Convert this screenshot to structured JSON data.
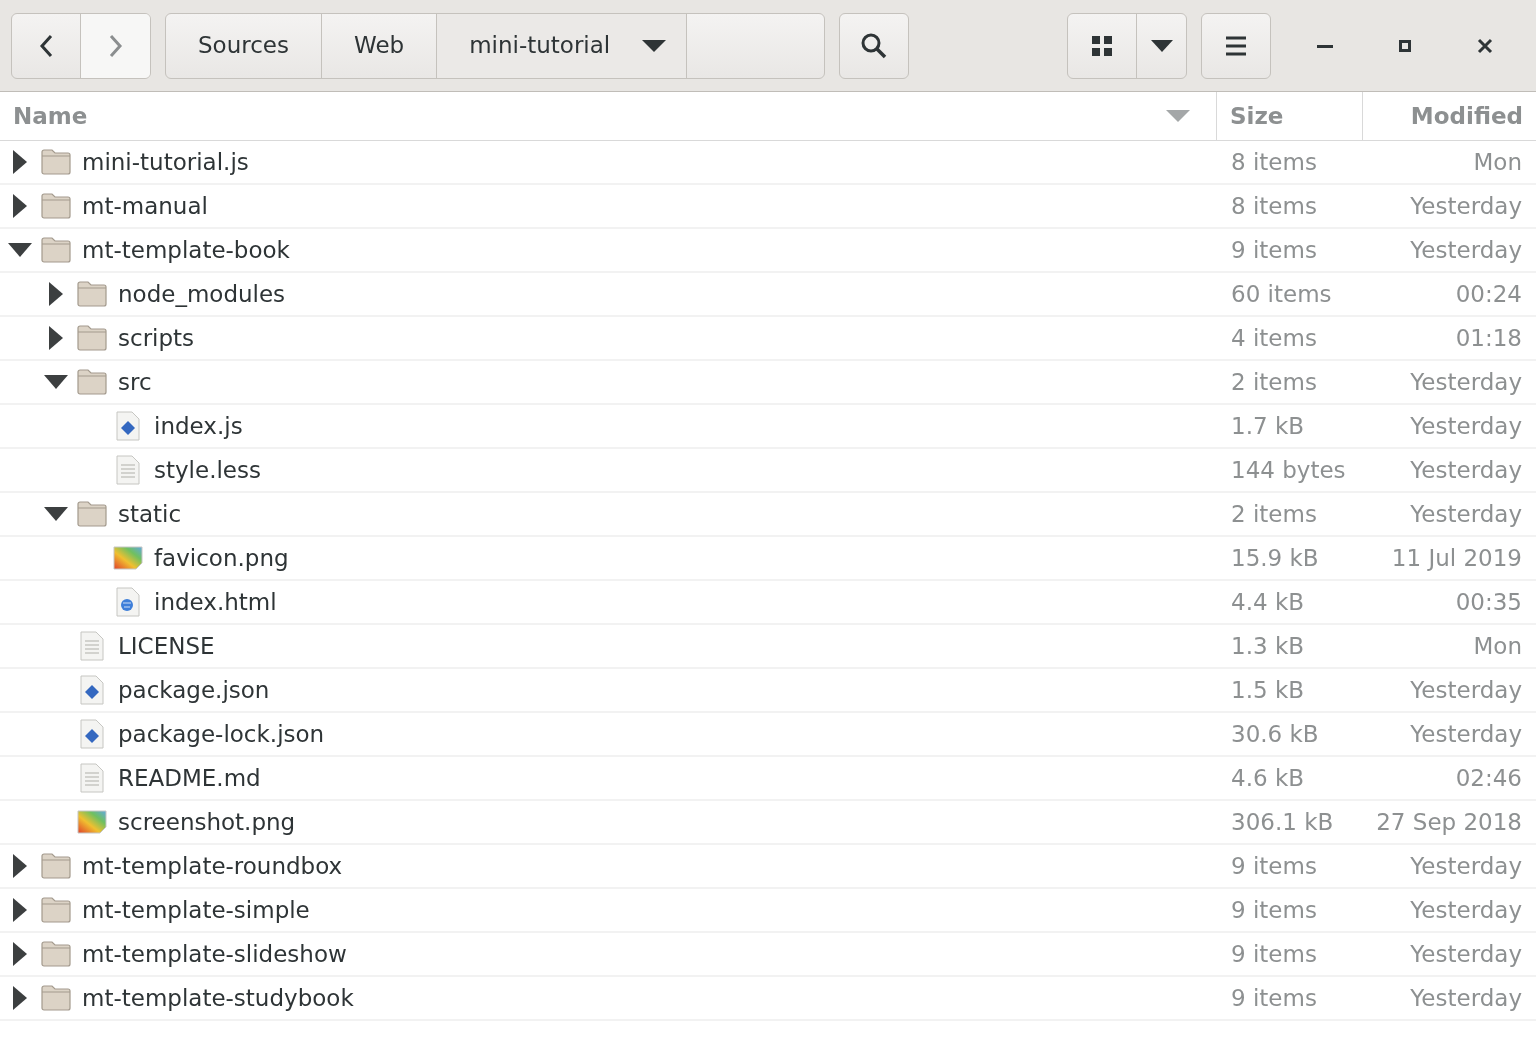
{
  "toolbar": {
    "path": [
      {
        "label": "Sources",
        "selected": false
      },
      {
        "label": "Web",
        "selected": false
      },
      {
        "label": "mini-tutorial",
        "selected": true
      }
    ]
  },
  "columns": [
    {
      "label": "Name",
      "sorted": true
    },
    {
      "label": "Size",
      "sorted": false
    },
    {
      "label": "Modified",
      "sorted": false
    }
  ],
  "files": [
    {
      "name": "mini-tutorial.js",
      "kind": "folder",
      "expanded": false,
      "size": "8 items",
      "modified": "Mon"
    },
    {
      "name": "mt-manual",
      "kind": "folder",
      "expanded": false,
      "size": "8 items",
      "modified": "Yesterday"
    },
    {
      "name": "mt-template-book",
      "kind": "folder",
      "expanded": true,
      "size": "9 items",
      "modified": "Yesterday",
      "children": [
        {
          "name": "node_modules",
          "kind": "folder",
          "expanded": false,
          "size": "60 items",
          "modified": "00:24"
        },
        {
          "name": "scripts",
          "kind": "folder",
          "expanded": false,
          "size": "4 items",
          "modified": "01:18"
        },
        {
          "name": "src",
          "kind": "folder",
          "expanded": true,
          "size": "2 items",
          "modified": "Yesterday",
          "children": [
            {
              "name": "index.js",
              "kind": "script",
              "size": "1.7 kB",
              "modified": "Yesterday"
            },
            {
              "name": "style.less",
              "kind": "text",
              "size": "144 bytes",
              "modified": "Yesterday"
            }
          ]
        },
        {
          "name": "static",
          "kind": "folder",
          "expanded": true,
          "size": "2 items",
          "modified": "Yesterday",
          "children": [
            {
              "name": "favicon.png",
              "kind": "image",
              "size": "15.9 kB",
              "modified": "11 Jul 2019"
            },
            {
              "name": "index.html",
              "kind": "web",
              "size": "4.4 kB",
              "modified": "00:35"
            }
          ]
        },
        {
          "name": "LICENSE",
          "kind": "text",
          "size": "1.3 kB",
          "modified": "Mon"
        },
        {
          "name": "package.json",
          "kind": "script",
          "size": "1.5 kB",
          "modified": "Yesterday"
        },
        {
          "name": "package-lock.json",
          "kind": "script",
          "size": "30.6 kB",
          "modified": "Yesterday"
        },
        {
          "name": "README.md",
          "kind": "text",
          "size": "4.6 kB",
          "modified": "02:46"
        },
        {
          "name": "screenshot.png",
          "kind": "image",
          "size": "306.1 kB",
          "modified": "27 Sep 2018"
        }
      ]
    },
    {
      "name": "mt-template-roundbox",
      "kind": "folder",
      "expanded": false,
      "size": "9 items",
      "modified": "Yesterday"
    },
    {
      "name": "mt-template-simple",
      "kind": "folder",
      "expanded": false,
      "size": "9 items",
      "modified": "Yesterday"
    },
    {
      "name": "mt-template-slideshow",
      "kind": "folder",
      "expanded": false,
      "size": "9 items",
      "modified": "Yesterday"
    },
    {
      "name": "mt-template-studybook",
      "kind": "folder",
      "expanded": false,
      "size": "9 items",
      "modified": "Yesterday"
    }
  ]
}
